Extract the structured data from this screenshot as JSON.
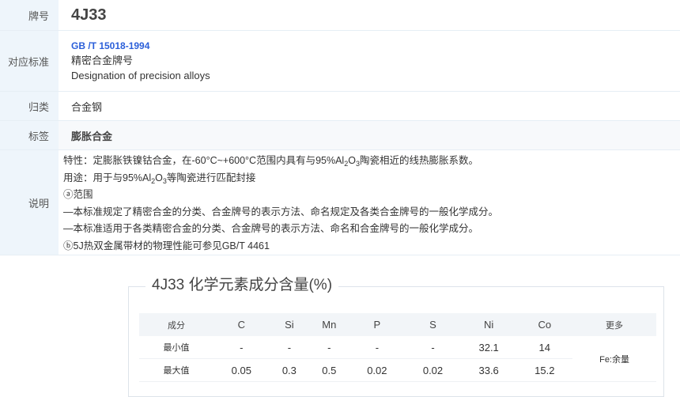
{
  "info": {
    "grade_label": "牌号",
    "grade_value": "4J33",
    "standard_label": "对应标准",
    "standard_code": "GB /T 15018-1994",
    "standard_name_cn": "精密合金牌号",
    "standard_name_en": "Designation of precision alloys",
    "category_label": "归类",
    "category_value": "合金钢",
    "tag_label": "标签",
    "tag_value": "膨胀合金",
    "desc_label": "说明",
    "desc_line1_a": "特性：定膨胀铁镍钴合金，在-60°C~+600°C范围内具有与95%Al",
    "desc_line1_sub1": "2",
    "desc_line1_b": "O",
    "desc_line1_sub2": "3",
    "desc_line1_c": "陶瓷相近的线热膨胀系数。",
    "desc_line2_a": "用途：用于与95%Al",
    "desc_line2_sub1": "2",
    "desc_line2_b": "O",
    "desc_line2_sub2": "3",
    "desc_line2_c": "等陶瓷进行匹配封接",
    "desc_line3": "ⓐ范围",
    "desc_line4": "—本标准规定了精密合金的分类、合金牌号的表示方法、命名规定及各类合金牌号的一般化学成分。",
    "desc_line5": "—本标准适用于各类精密合金的分类、合金牌号的表示方法、命名和合金牌号的一般化学成分。",
    "desc_line6": "ⓑ5J热双金属带材的物理性能可参见GB/T 4461"
  },
  "composition": {
    "title": "4J33 化学元素成分含量(%)",
    "headers": [
      "成分",
      "C",
      "Si",
      "Mn",
      "P",
      "S",
      "Ni",
      "Co",
      "更多"
    ],
    "rows": [
      {
        "label": "最小值",
        "values": [
          "-",
          "-",
          "-",
          "-",
          "-",
          "32.1",
          "14"
        ]
      },
      {
        "label": "最大值",
        "values": [
          "0.05",
          "0.3",
          "0.5",
          "0.02",
          "0.02",
          "33.6",
          "15.2"
        ]
      }
    ],
    "more": "Fe:余量"
  }
}
